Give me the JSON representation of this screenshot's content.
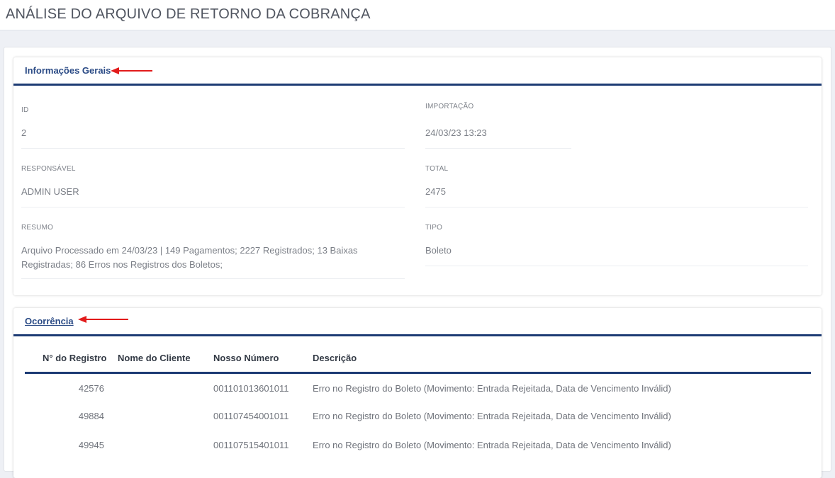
{
  "page": {
    "title": "ANÁLISE DO ARQUIVO DE RETORNO DA COBRANÇA"
  },
  "general": {
    "title": "Informações Gerais",
    "fields": {
      "id": {
        "label": "ID",
        "value": "2"
      },
      "importacao": {
        "label": "IMPORTAÇÃO",
        "value": "24/03/23 13:23"
      },
      "responsavel": {
        "label": "RESPONSÁVEL",
        "value": "ADMIN USER"
      },
      "total": {
        "label": "TOTAL",
        "value": "2475"
      },
      "resumo": {
        "label": "RESUMO",
        "value": "Arquivo Processado em 24/03/23 | 149 Pagamentos; 2227 Registrados; 13 Baixas Registradas; 86 Erros nos Registros dos Boletos;"
      },
      "tipo": {
        "label": "TIPO",
        "value": "Boleto"
      }
    }
  },
  "occurrence": {
    "title": "Ocorrência",
    "columns": {
      "registro": "N° do Registro",
      "cliente": "Nome do Cliente",
      "nosso_numero": "Nosso Número",
      "descricao": "Descrição"
    },
    "rows": [
      {
        "registro": "42576",
        "cliente": "",
        "nosso_numero": "001101013601011",
        "descricao": "Erro no Registro do Boleto (Movimento: Entrada Rejeitada, Data de Vencimento Inválid)"
      },
      {
        "registro": "49884",
        "cliente": "",
        "nosso_numero": "001107454001011",
        "descricao": "Erro no Registro do Boleto (Movimento: Entrada Rejeitada, Data de Vencimento Inválid)"
      },
      {
        "registro": "49945",
        "cliente": "",
        "nosso_numero": "001107515401011",
        "descricao": "Erro no Registro do Boleto (Movimento: Entrada Rejeitada, Data de Vencimento Inválid)"
      }
    ]
  },
  "colors": {
    "accent": "#1d3b74",
    "title_blue": "#2a4a85",
    "arrow_red": "#e21b1b"
  }
}
